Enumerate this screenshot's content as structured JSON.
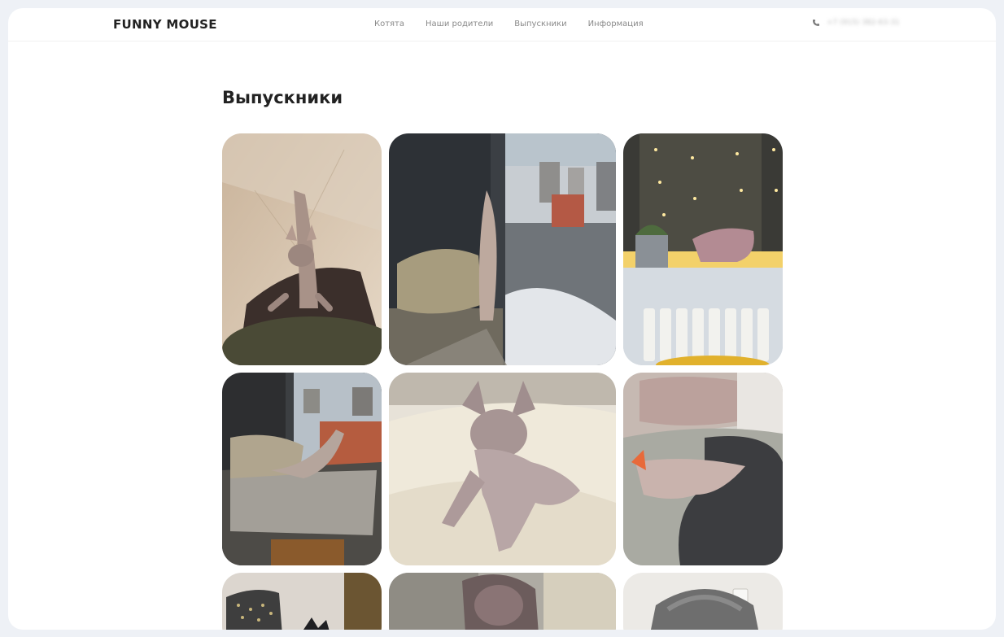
{
  "header": {
    "logo": "FUNNY MOUSE",
    "nav": [
      "Котята",
      "Наши родители",
      "Выпускники",
      "Информация"
    ],
    "phone_icon": "phone-icon",
    "phone": "+7 (915) 382-63-31"
  },
  "main": {
    "title": "Выпускники"
  },
  "gallery": {
    "photos": [
      {
        "subject": "cat-on-pillow-photo"
      },
      {
        "subject": "cat-at-window-photo"
      },
      {
        "subject": "cat-on-windowsill-lights-photo"
      },
      {
        "subject": "cat-stretching-photo"
      },
      {
        "subject": "cat-on-bed-photo"
      },
      {
        "subject": "cat-sleeping-sun-photo"
      },
      {
        "subject": "cat-with-pillow-photo"
      },
      {
        "subject": "cat-closeup-photo"
      },
      {
        "subject": "cat-in-blanket-photo"
      }
    ]
  }
}
